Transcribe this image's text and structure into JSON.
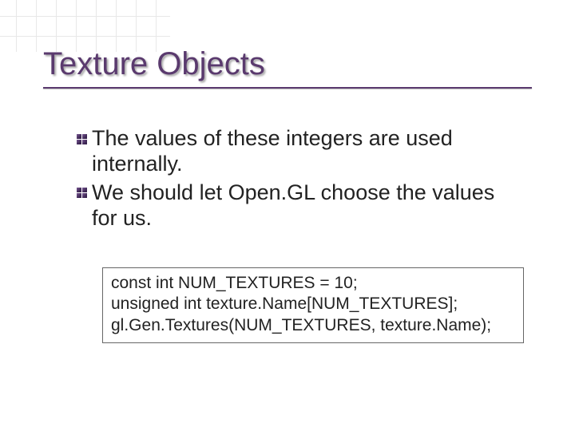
{
  "title": "Texture Objects",
  "bullets": [
    "The values of these integers are used internally.",
    "We should let Open.GL choose the values for us."
  ],
  "code_lines": [
    "const int NUM_TEXTURES = 10;",
    "unsigned int texture.Name[NUM_TEXTURES];",
    "gl.Gen.Textures(NUM_TEXTURES, texture.Name);"
  ]
}
